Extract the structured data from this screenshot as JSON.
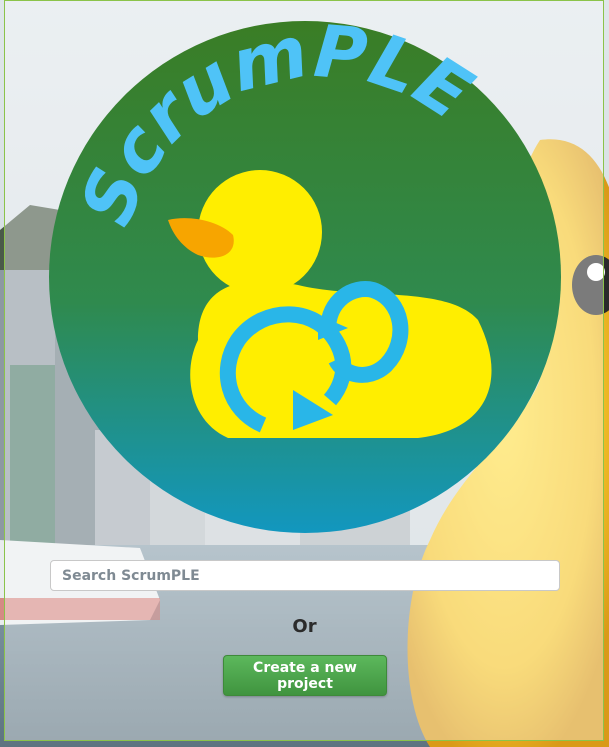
{
  "brand": {
    "logo_text": "ScrumPLE",
    "colors": {
      "circle_top": "#3a7d25",
      "circle_bottom": "#1297bf",
      "logo_text": "#4fc3f7",
      "duck": "#ffee00",
      "beak": "#f7a500",
      "loop": "#29b6e8"
    }
  },
  "search": {
    "placeholder": "Search ScrumPLE",
    "value": ""
  },
  "divider_text": "Or",
  "create_button": {
    "label": "Create a new project",
    "color": "#5cb85c"
  },
  "background": {
    "description_icon": "harbor-duck-photo-icon"
  }
}
